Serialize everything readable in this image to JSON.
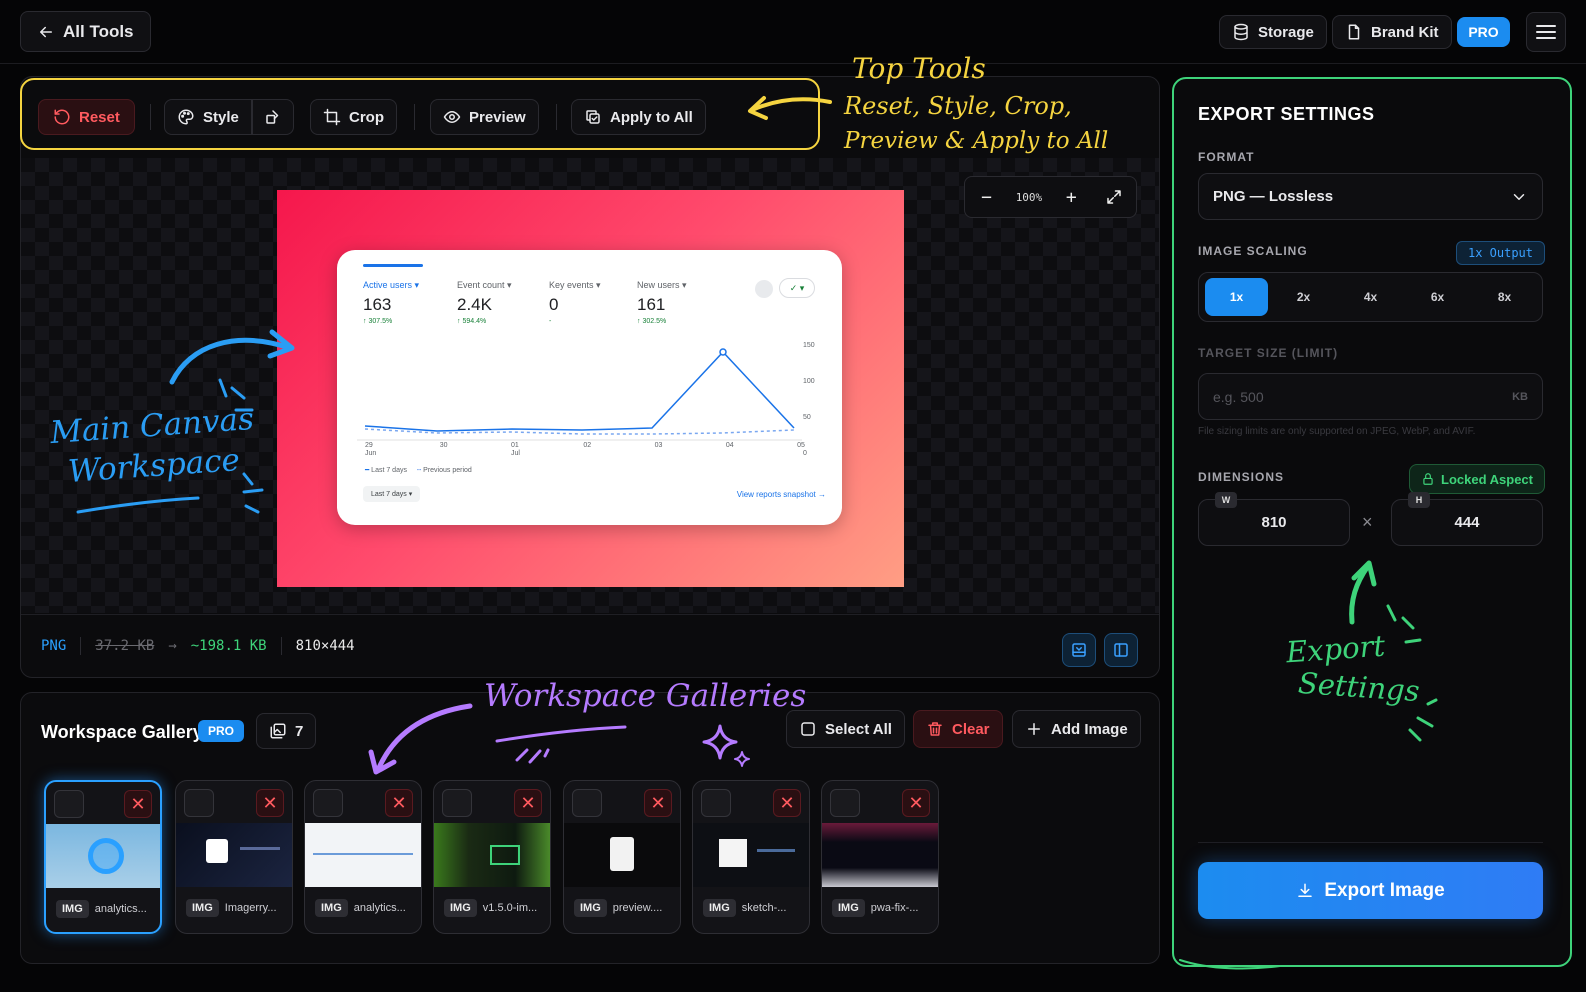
{
  "topbar": {
    "back_label": "All Tools",
    "storage_label": "Storage",
    "brandkit_label": "Brand Kit",
    "pro_label": "PRO"
  },
  "toolbar": {
    "reset_label": "Reset",
    "style_label": "Style",
    "crop_label": "Crop",
    "preview_label": "Preview",
    "apply_label": "Apply to All"
  },
  "canvas": {
    "zoom": "100%",
    "preview_card": {
      "metrics": [
        {
          "label": "Active users ▾",
          "value": "163",
          "change": "↑ 307.5%"
        },
        {
          "label": "Event count ▾",
          "value": "2.4K",
          "change": "↑ 594.4%"
        },
        {
          "label": "Key events ▾",
          "value": "0",
          "change": "-"
        },
        {
          "label": "New users ▾",
          "value": "161",
          "change": "↑ 302.5%"
        }
      ],
      "y_ticks": [
        "150",
        "100",
        "50",
        "0"
      ],
      "x_ticks": [
        "29\nJun",
        "30",
        "01\nJul",
        "02",
        "03",
        "04",
        "05"
      ],
      "legend": [
        "Last 7 days",
        "Previous period"
      ],
      "range_label": "Last 7 days ▾",
      "snapshot_link": "View reports snapshot →"
    }
  },
  "infobar": {
    "format": "PNG",
    "original_size": "37.2 KB",
    "new_size": "~198.1 KB",
    "dimensions": "810×444"
  },
  "gallery": {
    "title": "Workspace Gallery",
    "pro_label": "PRO",
    "count": "7",
    "select_all_label": "Select All",
    "clear_label": "Clear",
    "add_label": "Add Image",
    "items": [
      {
        "tag": "IMG",
        "name": "analytics...",
        "selected": true
      },
      {
        "tag": "IMG",
        "name": "Imagerry...",
        "selected": false
      },
      {
        "tag": "IMG",
        "name": "analytics...",
        "selected": false
      },
      {
        "tag": "IMG",
        "name": "v1.5.0-im...",
        "selected": false
      },
      {
        "tag": "IMG",
        "name": "preview....",
        "selected": false
      },
      {
        "tag": "IMG",
        "name": "sketch-...",
        "selected": false
      },
      {
        "tag": "IMG",
        "name": "pwa-fix-...",
        "selected": false
      }
    ]
  },
  "export": {
    "title": "EXPORT SETTINGS",
    "format_label": "FORMAT",
    "format_value": "PNG — Lossless",
    "scaling_label": "IMAGE SCALING",
    "scaling_badge": "1x Output",
    "scales": [
      "1x",
      "2x",
      "4x",
      "6x",
      "8x"
    ],
    "active_scale": "1x",
    "target_label": "TARGET SIZE (LIMIT)",
    "target_placeholder": "e.g. 500",
    "target_unit": "KB",
    "target_hint": "File sizing limits are only supported on JPEG, WebP, and AVIF.",
    "dimensions_label": "DIMENSIONS",
    "locked_label": "Locked Aspect",
    "width_tag": "W",
    "height_tag": "H",
    "width": "810",
    "height": "444",
    "export_label": "Export Image"
  },
  "annotations": {
    "top_tools_title": "Top Tools",
    "top_tools_line1": "Reset, Style, Crop,",
    "top_tools_line2": "Preview & Apply to All",
    "canvas_line1": "Main Canvas",
    "canvas_line2": "Workspace",
    "galleries": "Workspace Galleries",
    "export_line1": "Export",
    "export_line2": "Settings"
  },
  "colors": {
    "accent_blue": "#1b8cf0",
    "danger": "#ff5a5f",
    "success": "#3ed37a",
    "highlight_yellow": "#f5d440",
    "annotation_blue": "#2a9df4",
    "annotation_purple": "#b57bff"
  }
}
